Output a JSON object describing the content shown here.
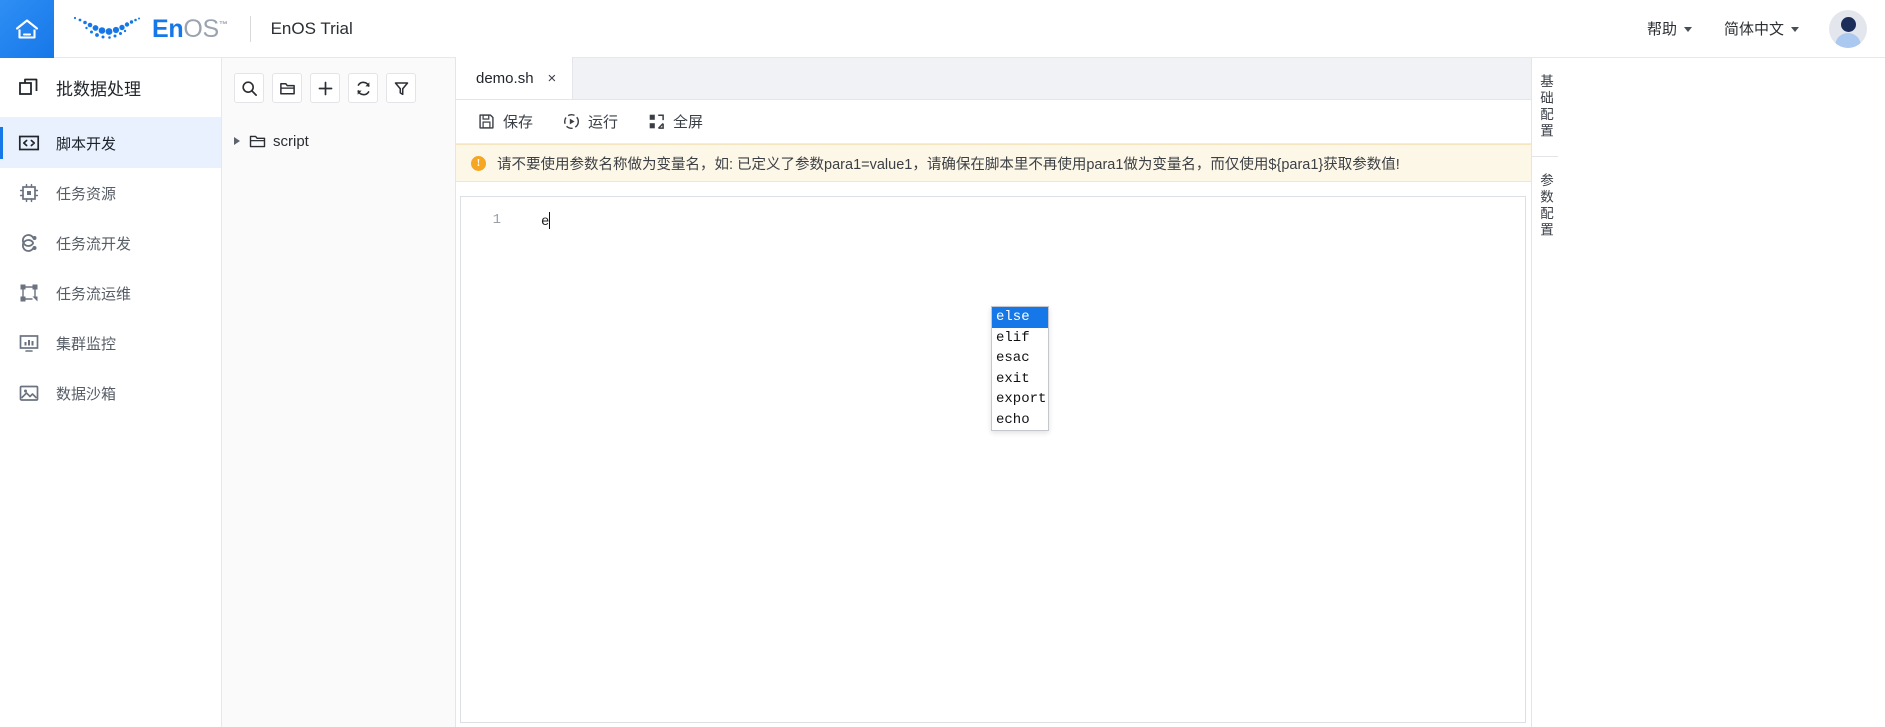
{
  "topbar": {
    "home_icon": "home-icon",
    "logo_text_en": "En",
    "logo_text_os": "OS",
    "logo_tm": "™",
    "app_title": "EnOS Trial",
    "help_label": "帮助",
    "language_label": "简体中文",
    "avatar": "user-avatar"
  },
  "sidebar": {
    "header": {
      "label": "批数据处理",
      "icon": "layers-icon"
    },
    "items": [
      {
        "label": "脚本开发",
        "icon": "code-brackets-icon",
        "active": true
      },
      {
        "label": "任务资源",
        "icon": "chip-icon",
        "active": false
      },
      {
        "label": "任务流开发",
        "icon": "workflow-icon",
        "active": false
      },
      {
        "label": "任务流运维",
        "icon": "nodes-icon",
        "active": false
      },
      {
        "label": "集群监控",
        "icon": "monitor-chart-icon",
        "active": false
      },
      {
        "label": "数据沙箱",
        "icon": "sandbox-image-icon",
        "active": false
      }
    ]
  },
  "file_panel": {
    "toolbar": [
      {
        "name": "search-icon",
        "title": "搜索"
      },
      {
        "name": "folder-icon",
        "title": "新建文件夹"
      },
      {
        "name": "plus-icon",
        "title": "新建"
      },
      {
        "name": "refresh-icon",
        "title": "刷新"
      },
      {
        "name": "filter-icon",
        "title": "筛选"
      }
    ],
    "tree": [
      {
        "label": "script",
        "icon": "folder-icon",
        "expanded": false
      }
    ]
  },
  "editor": {
    "tabs": [
      {
        "label": "demo.sh",
        "close": "×",
        "active": true
      }
    ],
    "toolbar": [
      {
        "label": "保存",
        "icon": "save-icon"
      },
      {
        "label": "运行",
        "icon": "run-play-icon"
      },
      {
        "label": "全屏",
        "icon": "fullscreen-icon"
      }
    ],
    "warning": {
      "icon": "warning-icon",
      "badge": "!",
      "text": "请不要使用参数名称做为变量名，如: 已定义了参数para1=value1，请确保在脚本里不再使用para1做为变量名，而仅使用${para1}获取参数值!"
    },
    "code": {
      "line_number": "1",
      "content": "e"
    },
    "autocomplete": {
      "items": [
        {
          "label": "else",
          "selected": true
        },
        {
          "label": "elif",
          "selected": false
        },
        {
          "label": "esac",
          "selected": false
        },
        {
          "label": "exit",
          "selected": false
        },
        {
          "label": "export",
          "selected": false
        },
        {
          "label": "echo",
          "selected": false
        }
      ]
    }
  },
  "right_rail": {
    "tabs": [
      {
        "label": "基础配置"
      },
      {
        "label": "参数配置"
      }
    ]
  },
  "colors": {
    "accent": "#1677e8",
    "active_nav_bg": "#e8f1fd",
    "warning_bg": "#fdf7e8",
    "warning_icon": "#f5a623",
    "panel_bg": "#fafafa"
  }
}
